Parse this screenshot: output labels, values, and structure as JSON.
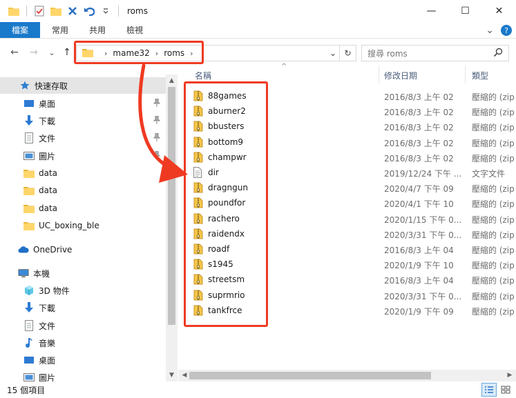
{
  "window": {
    "title": "roms",
    "minimize_glyph": "—",
    "maximize_glyph": "☐",
    "close_glyph": "✕"
  },
  "ribbon": {
    "file_tab": "檔案",
    "tabs": [
      "常用",
      "共用",
      "檢視"
    ],
    "expand_glyph": "⌄",
    "help_glyph": "?"
  },
  "nav": {
    "back_glyph": "←",
    "forward_glyph": "→",
    "recent_glyph": "⌄",
    "up_glyph": "↑",
    "breadcrumb": [
      "mame32",
      "roms"
    ],
    "crumb_sep": "›",
    "dropdown_glyph": "⌄",
    "refresh_glyph": "↻",
    "search_placeholder": "搜尋 roms",
    "search_glyph": "⚲"
  },
  "sidebar": {
    "quick_access": "快速存取",
    "quick_items": [
      "桌面",
      "下載",
      "文件",
      "圖片",
      "data",
      "data",
      "data",
      "UC_boxing_ble"
    ],
    "onedrive": "OneDrive",
    "this_pc": "本機",
    "pc_items": [
      "3D 物件",
      "下載",
      "文件",
      "音樂",
      "桌面",
      "圖片"
    ],
    "pin_glyph": "📌",
    "up_arrow": "▲",
    "down_arrow": "▼"
  },
  "columns": {
    "name": "名稱",
    "date": "修改日期",
    "type": "類型",
    "sort_glyph": "^"
  },
  "files": [
    {
      "name": "88games",
      "date": "2016/8/3 上午 02",
      "type": "壓縮的 (zip",
      "kind": "zip"
    },
    {
      "name": "aburner2",
      "date": "2016/8/3 上午 02",
      "type": "壓縮的 (zip",
      "kind": "zip"
    },
    {
      "name": "bbusters",
      "date": "2016/8/3 上午 02",
      "type": "壓縮的 (zip",
      "kind": "zip"
    },
    {
      "name": "bottom9",
      "date": "2016/8/3 上午 02",
      "type": "壓縮的 (zip",
      "kind": "zip"
    },
    {
      "name": "champwr",
      "date": "2016/8/3 上午 02",
      "type": "壓縮的 (zip",
      "kind": "zip"
    },
    {
      "name": "dir",
      "date": "2019/12/24 下午 ...",
      "type": "文字文件",
      "kind": "txt"
    },
    {
      "name": "dragngun",
      "date": "2020/4/7 下午 09",
      "type": "壓縮的 (zip",
      "kind": "zip"
    },
    {
      "name": "poundfor",
      "date": "2020/4/1 下午 10",
      "type": "壓縮的 (zip",
      "kind": "zip"
    },
    {
      "name": "rachero",
      "date": "2020/1/15 下午 0...",
      "type": "壓縮的 (zip",
      "kind": "zip"
    },
    {
      "name": "raidendx",
      "date": "2020/3/31 下午 0...",
      "type": "壓縮的 (zip",
      "kind": "zip"
    },
    {
      "name": "roadf",
      "date": "2016/8/3 上午 04",
      "type": "壓縮的 (zip",
      "kind": "zip"
    },
    {
      "name": "s1945",
      "date": "2020/1/9 下午 10",
      "type": "壓縮的 (zip",
      "kind": "zip"
    },
    {
      "name": "streetsm",
      "date": "2016/8/3 上午 04",
      "type": "壓縮的 (zip",
      "kind": "zip"
    },
    {
      "name": "suprmrio",
      "date": "2020/3/31 下午 0...",
      "type": "壓縮的 (zip",
      "kind": "zip"
    },
    {
      "name": "tankfrce",
      "date": "2020/1/9 下午 09",
      "type": "壓縮的 (zip",
      "kind": "zip"
    }
  ],
  "scroll": {
    "left_arrow": "◀",
    "right_arrow": "▶"
  },
  "status": {
    "count": "15 個項目"
  },
  "colors": {
    "accent": "#1979ca",
    "highlight": "#ef3a22",
    "folder": "#f5c54a",
    "zip_stripe": "#8a6d1a"
  }
}
